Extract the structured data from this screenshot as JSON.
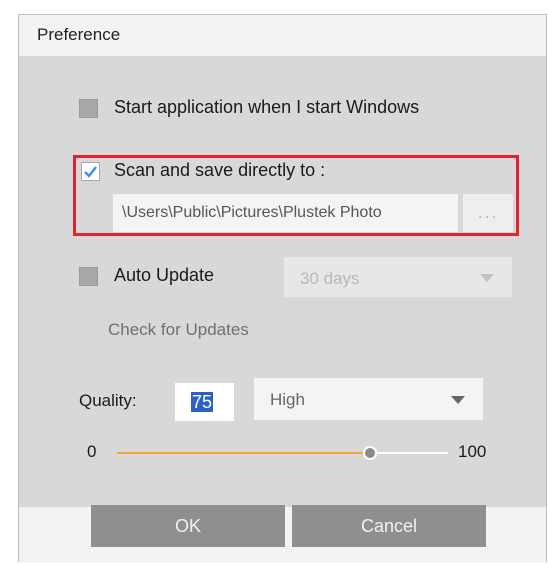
{
  "dialog": {
    "title": "Preference"
  },
  "startup": {
    "label": "Start application when I start Windows",
    "checked": false
  },
  "scan_save": {
    "label": "Scan and save directly to :",
    "checked": true,
    "path_value": "\\Users\\Public\\Pictures\\Plustek Photo",
    "browse_label": "..."
  },
  "auto_update": {
    "label": "Auto Update",
    "checked": false,
    "interval_selected": "30 days",
    "check_link": "Check for Updates"
  },
  "quality": {
    "label": "Quality:",
    "value": "75",
    "preset_selected": "High",
    "slider_min": "0",
    "slider_max": "100"
  },
  "buttons": {
    "ok": "OK",
    "cancel": "Cancel"
  },
  "colors": {
    "highlight_border": "#e0252a",
    "slider_fill": "#f2a93b",
    "checkbox_check": "#3a8ee0",
    "selection": "#2b61c6"
  }
}
